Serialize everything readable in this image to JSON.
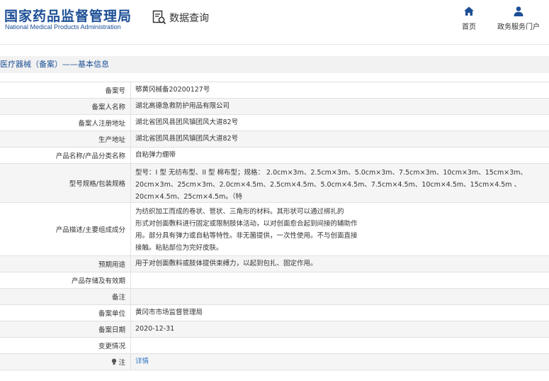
{
  "header": {
    "logo_cn": "国家药品监督管理局",
    "logo_en": "National Medical Products Administration",
    "query_label": "数据查询",
    "nav": [
      {
        "label": "首页",
        "icon": "home-icon"
      },
      {
        "label": "政务服务门户",
        "icon": "user-icon"
      }
    ]
  },
  "breadcrumb": "医疗器械（备案）——基本信息",
  "rows": [
    {
      "label": "备案号",
      "value": "鄂黄冈械备20200127号"
    },
    {
      "label": "备案人名称",
      "value": "湖北高德急救防护用品有限公司"
    },
    {
      "label": "备案人注册地址",
      "value": "湖北省团风县团风镇团风大道82号"
    },
    {
      "label": "生产地址",
      "value": "湖北省团风县团风镇团风大道82号"
    },
    {
      "label": "产品名称/产品分类名称",
      "value": "自粘弹力绷带"
    },
    {
      "label": "型号规格/包装规格",
      "value": "型号：I 型 无纺布型、II 型 棉布型；规格： 2.0cm×3m、2.5cm×3m、5.0cm×3m、7.5cm×3m、10cm×3m、15cm×3m、20cm×3m、25cm×3m、2.0cm×4.5m、2.5cm×4.5m、5.0cm×4.5m、7.5cm×4.5m、10cm×4.5m、15cm×4.5m 、20cm×4.5m、25cm×4.5m。（特"
    },
    {
      "label": "产品描述/主要组成成分",
      "value_lines": [
        "为纺织加工而成的卷状、管状、三角形的材料。其形状可以通过绑扎的",
        "形式对创面敷料进行固定或限制肢体活动，以对创面愈合起到间接的辅助作",
        "用。部分具有弹力或自粘等特性。非无菌提供，一次性使用。不与创面直接",
        "接触。粘贴部位为完好皮肤。"
      ]
    },
    {
      "label": "预期用途",
      "value": "用于对创面敷料或肢体提供束缚力，以起到包扎、固定作用。"
    },
    {
      "label": "产品存储及有效期",
      "value": ""
    },
    {
      "label": "备注",
      "value": ""
    },
    {
      "label": "备案单位",
      "value": "黄冈市市场监督管理局"
    },
    {
      "label": "备案日期",
      "value": "2020-12-31"
    },
    {
      "label": "变更情况",
      "value": ""
    },
    {
      "label": "注",
      "value": "详情"
    }
  ],
  "colors": {
    "brand": "#1d4f96",
    "link": "#2a74c4",
    "alt_row": "#f5f5f5",
    "breadcrumb_bg": "#f2f2f2"
  }
}
